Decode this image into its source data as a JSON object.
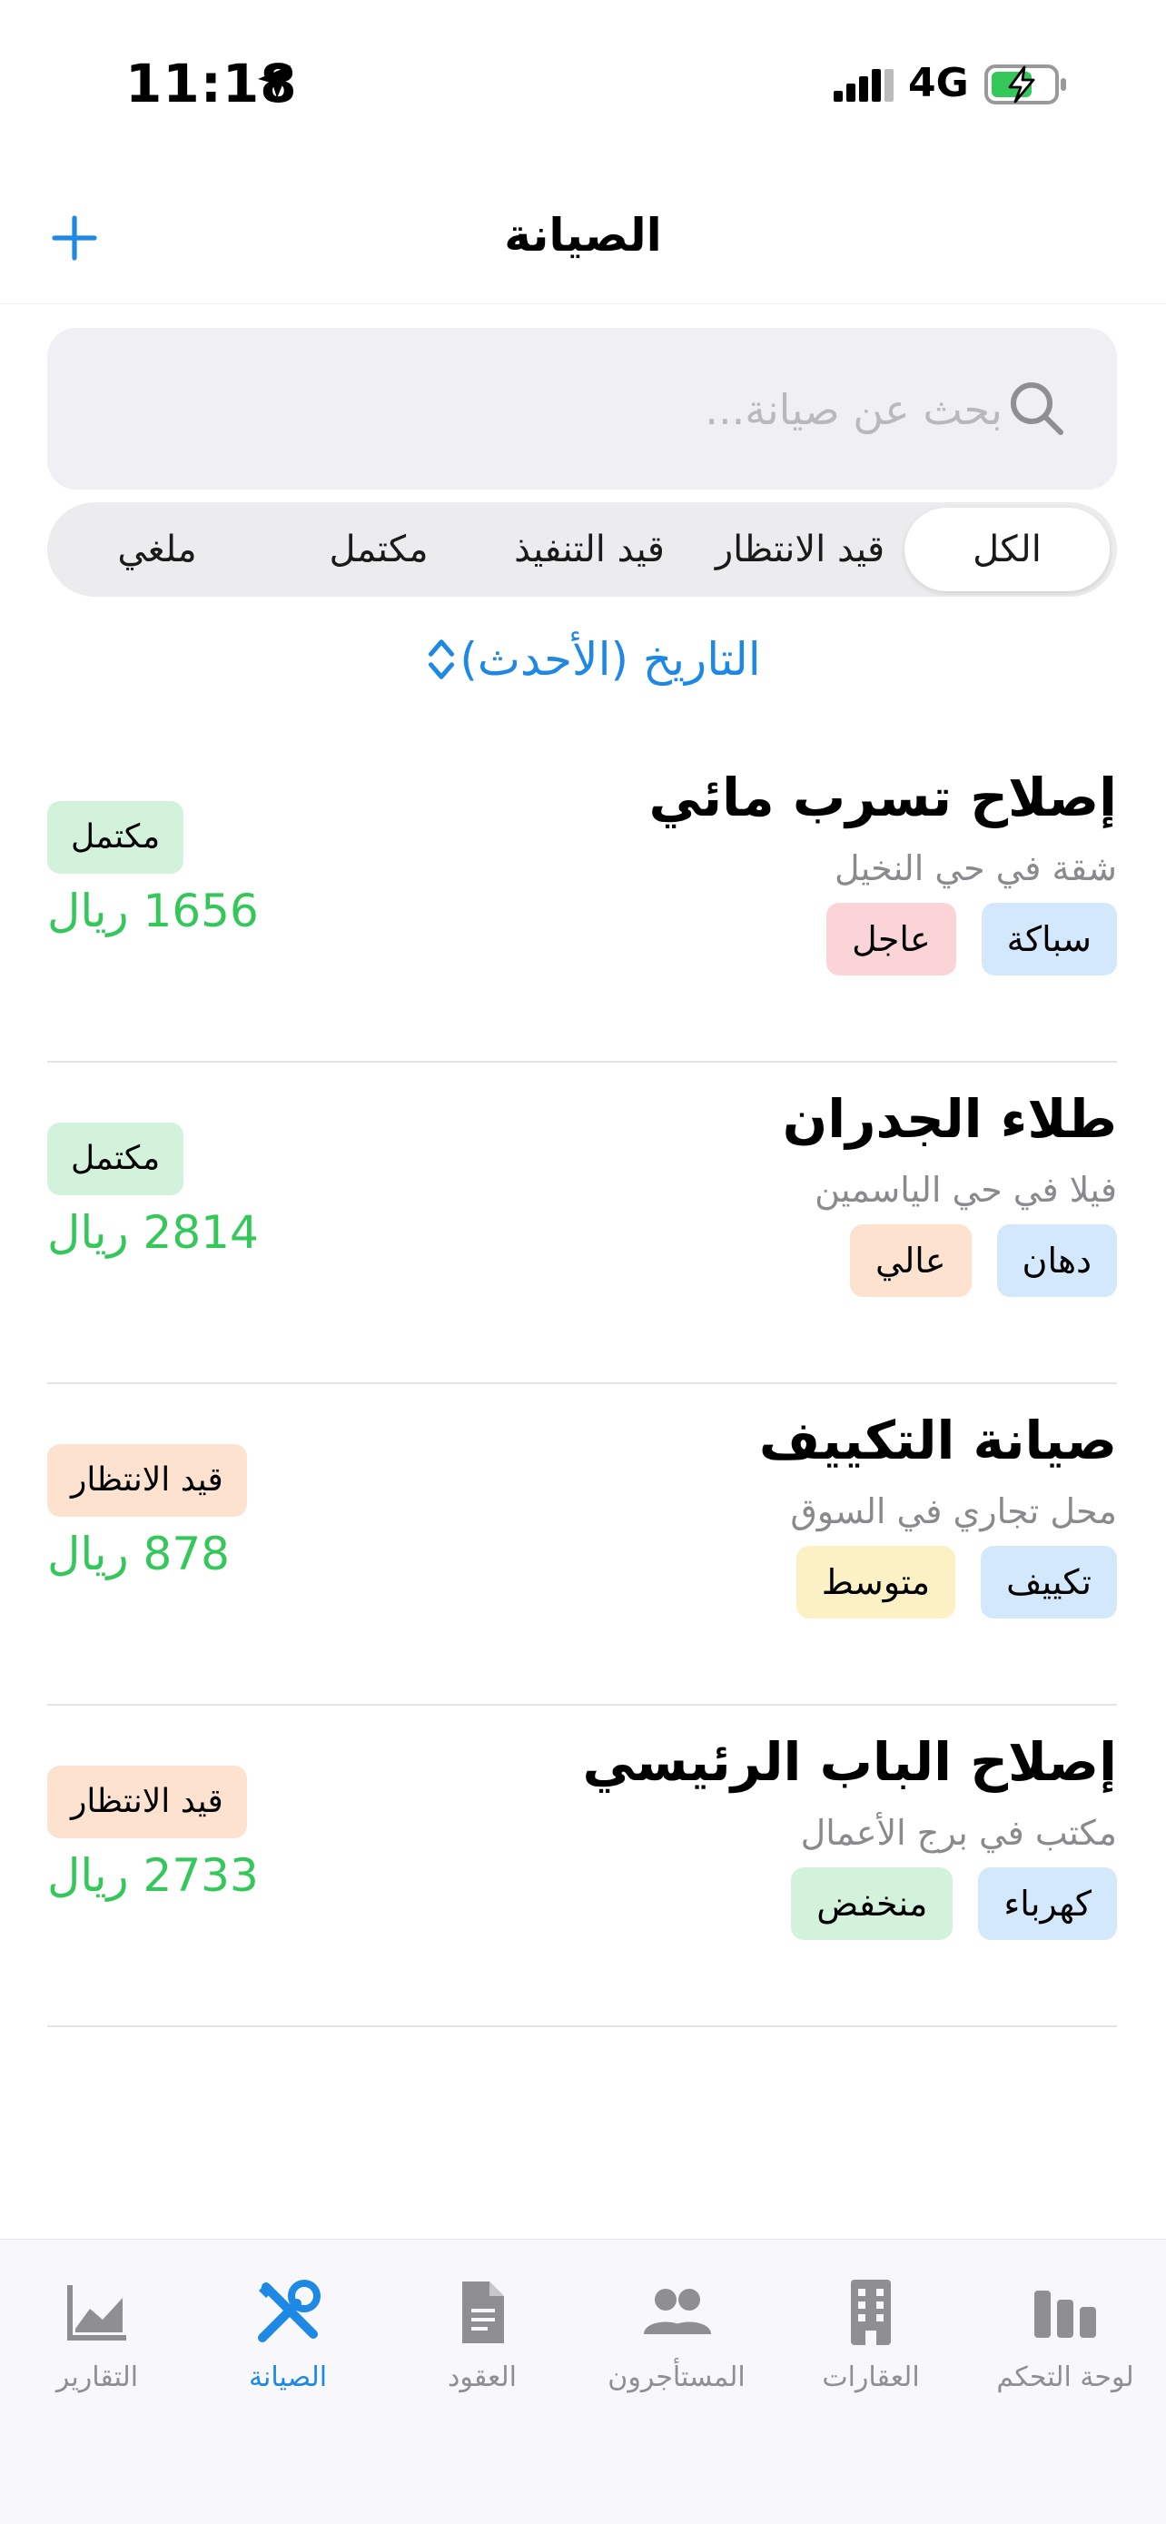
{
  "status_bar": {
    "time": "11:18",
    "network": "4G"
  },
  "nav": {
    "title": "الصيانة"
  },
  "search": {
    "placeholder": "بحث عن صيانة..."
  },
  "filters": [
    "الكل",
    "قيد الانتظار",
    "قيد التنفيذ",
    "مكتمل",
    "ملغي"
  ],
  "active_filter": "الكل",
  "sort": {
    "label": "التاريخ (الأحدث)"
  },
  "items": [
    {
      "title": "إصلاح تسرب مائي",
      "subtitle": "شقة في حي النخيل",
      "category": "سباكة",
      "priority": "عاجل",
      "status": "مكتمل",
      "price": "1656 ريال"
    },
    {
      "title": "طلاء الجدران",
      "subtitle": "فيلا في حي الياسمين",
      "category": "دهان",
      "priority": "عالي",
      "status": "مكتمل",
      "price": "2814 ريال"
    },
    {
      "title": "صيانة التكييف",
      "subtitle": "محل تجاري في السوق",
      "category": "تكييف",
      "priority": "متوسط",
      "status": "قيد الانتظار",
      "price": "878 ريال"
    },
    {
      "title": "إصلاح الباب الرئيسي",
      "subtitle": "مكتب في برج الأعمال",
      "category": "كهرباء",
      "priority": "منخفض",
      "status": "قيد الانتظار",
      "price": "2733 ريال"
    }
  ],
  "tabs": [
    {
      "label": "لوحة التحكم",
      "icon": "dashboard-icon"
    },
    {
      "label": "العقارات",
      "icon": "building-icon"
    },
    {
      "label": "المستأجرون",
      "icon": "people-icon"
    },
    {
      "label": "العقود",
      "icon": "document-icon"
    },
    {
      "label": "الصيانة",
      "icon": "tools-icon"
    },
    {
      "label": "التقارير",
      "icon": "chart-icon"
    }
  ],
  "active_tab": "الصيانة",
  "colors": {
    "accent": "#1e88e5",
    "price": "#34c759",
    "tag_category_bg": "#d4e8fb",
    "priority_urgent_bg": "#fbd4d8",
    "priority_high_bg": "#fde2cf",
    "priority_medium_bg": "#fcf1c4",
    "priority_low_bg": "#d3f2dc",
    "status_done_bg": "#d3f2dc",
    "status_pending_bg": "#fde2cf"
  }
}
